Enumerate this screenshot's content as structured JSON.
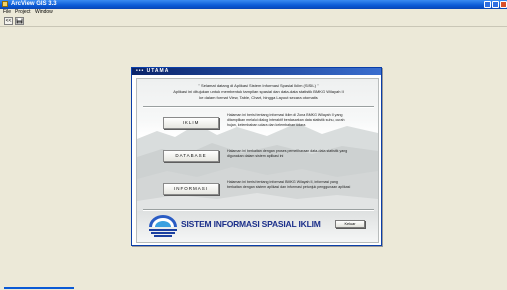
{
  "window": {
    "title": "ArcView GIS 3.3"
  },
  "menu": {
    "items": [
      "File",
      "Project",
      "Window"
    ]
  },
  "toolbar": {
    "buttons": [
      "<<",
      "save"
    ]
  },
  "dialog": {
    "title": "UTAMA",
    "welcome": [
      "\" Selamat datang di Aplikasi Sistem Informasi Spasial Iklim (SISIL) \"",
      "Aplikasi ini ditujukan untuk membentuk tampilan spasial dan data-data statistik BMKG Wilayah II",
      "ke dalam format View, Table, Chart, hingga Layout secara otomatis"
    ],
    "nav": [
      {
        "label": "IKLIM",
        "desc": "Halaman ini berisi tentang informasi iklim di Zona BMKG Wilayah II yang ditampilkan melalui dialog interaktif berdasarkan data statistik suhu, curah hujan, kelembaban udara dan kelembaban udara"
      },
      {
        "label": "DATABASE",
        "desc": "Halaman ini berkaitan dengan proses pemeliharaan data-data statistik yang digunakan dalam sistem aplikasi ini"
      },
      {
        "label": "INFORMASI",
        "desc": "Halaman ini berisi tentang informasi BMKG Wilayah II, informasi yang berkaitan dengan sistem aplikasi dan informasi petunjuk penggunaan aplikasi"
      }
    ],
    "logo_text": "SISTEM INFORMASI SPASIAL IKLIM",
    "exit_label": "Keluar"
  },
  "colors": {
    "titlebar": "#0a5ad6",
    "desktop": "#ece9d8",
    "dialog_title": "#0a246a",
    "logo_text": "#1b2f8a"
  }
}
